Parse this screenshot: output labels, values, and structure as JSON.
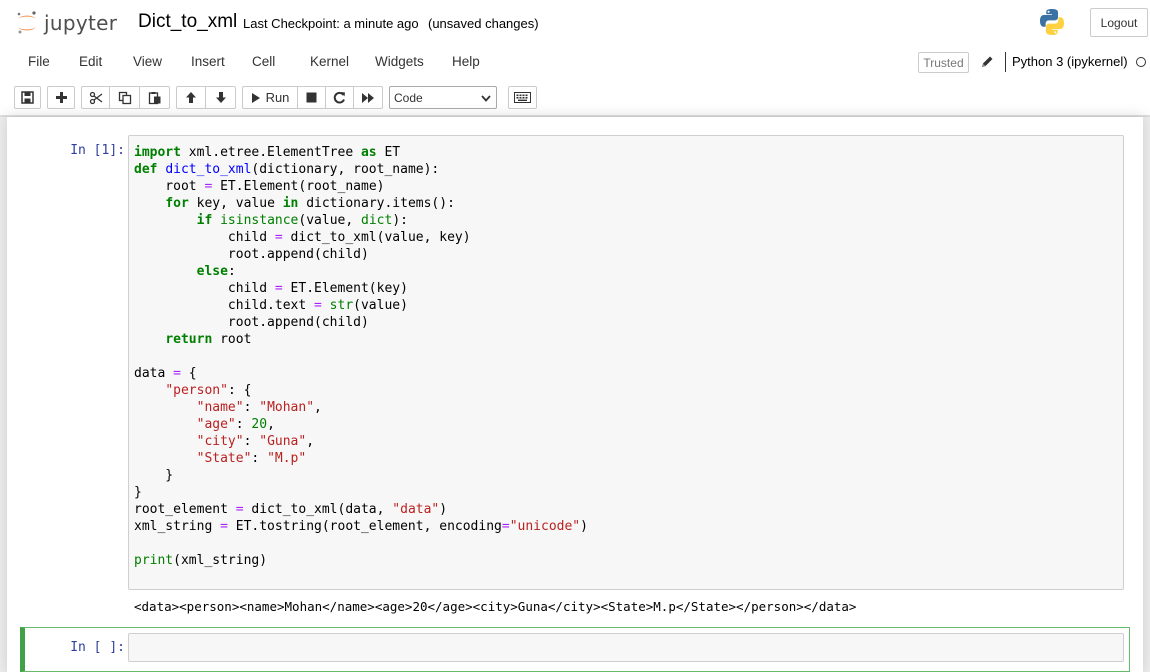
{
  "header": {
    "logo_text": "jupyter",
    "notebook_name": "Dict_to_xml",
    "checkpoint": "Last Checkpoint: a minute ago",
    "unsaved": "(unsaved changes)",
    "logout_label": "Logout"
  },
  "menu": [
    "File",
    "Edit",
    "View",
    "Insert",
    "Cell",
    "Kernel",
    "Widgets",
    "Help"
  ],
  "kernel": {
    "trusted_label": "Trusted",
    "name": "Python 3 (ipykernel)"
  },
  "toolbar": {
    "run_label": "Run",
    "cell_type": "Code",
    "icons": [
      "save-icon",
      "plus-icon",
      "cut-icon",
      "copy-icon",
      "paste-icon",
      "arrow-up-icon",
      "arrow-down-icon",
      "play-icon",
      "stop-icon",
      "restart-icon",
      "fast-forward-icon",
      "keyboard-icon"
    ]
  },
  "cells": [
    {
      "prompt": "In [1]:",
      "code_lines": [
        "import xml.etree.ElementTree as ET",
        "def dict_to_xml(dictionary, root_name):",
        "    root = ET.Element(root_name)",
        "    for key, value in dictionary.items():",
        "        if isinstance(value, dict):",
        "            child = dict_to_xml(value, key)",
        "            root.append(child)",
        "        else:",
        "            child = ET.Element(key)",
        "            child.text = str(value)",
        "            root.append(child)",
        "    return root",
        "",
        "data = {",
        "    \"person\": {",
        "        \"name\": \"Mohan\",",
        "        \"age\": 20,",
        "        \"city\": \"Guna\",",
        "        \"State\": \"M.p\"",
        "    }",
        "}",
        "root_element = dict_to_xml(data, \"data\")",
        "xml_string = ET.tostring(root_element, encoding=\"unicode\")",
        "",
        "print(xml_string)"
      ],
      "output": "<data><person><name>Mohan</name><age>20</age><city>Guna</city><State>M.p</State></person></data>"
    },
    {
      "prompt": "In [ ]:",
      "code_lines": []
    }
  ]
}
